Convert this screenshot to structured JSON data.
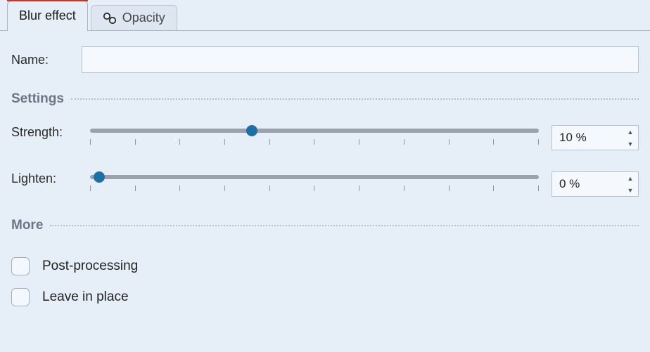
{
  "tabs": [
    {
      "label": "Blur effect",
      "active": true
    },
    {
      "label": "Opacity",
      "active": false
    }
  ],
  "name": {
    "label": "Name:",
    "value": ""
  },
  "sections": {
    "settings": "Settings",
    "more": "More"
  },
  "sliders": {
    "strength": {
      "label": "Strength:",
      "value": "10 %",
      "percent": 36,
      "ticks": 11
    },
    "lighten": {
      "label": "Lighten:",
      "value": "0 %",
      "percent": 2,
      "ticks": 11
    }
  },
  "checks": {
    "postproc": {
      "label": "Post-processing",
      "checked": false
    },
    "leave": {
      "label": "Leave in place",
      "checked": false
    }
  }
}
